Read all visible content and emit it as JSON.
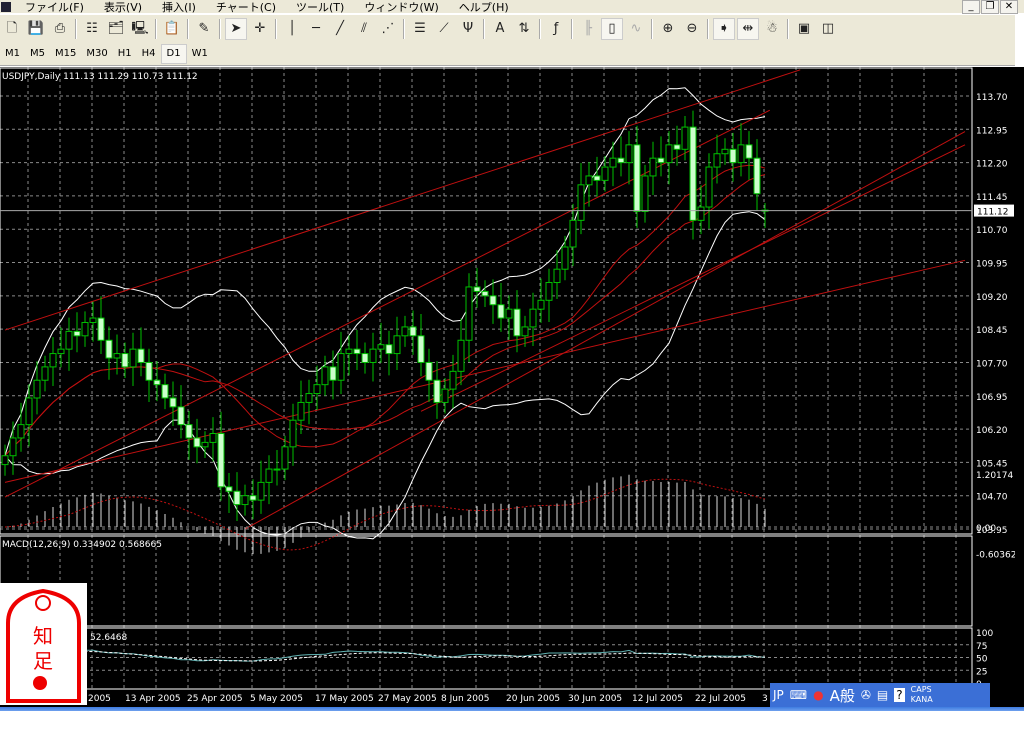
{
  "menu": [
    "ファイル(F)",
    "表示(V)",
    "挿入(I)",
    "チャート(C)",
    "ツール(T)",
    "ウィンドウ(W)",
    "ヘルプ(H)"
  ],
  "window_buttons": {
    "minimize": "_",
    "restore": "❐",
    "close": "✕"
  },
  "toolbar": [
    {
      "icon": "new-chart-icon",
      "g": "🗋"
    },
    {
      "icon": "save-icon",
      "g": "💾"
    },
    {
      "icon": "print-icon",
      "g": "⎙"
    },
    "|",
    {
      "icon": "market-watch-icon",
      "g": "☷"
    },
    {
      "icon": "navigator-icon",
      "g": "🗂"
    },
    {
      "icon": "terminal-icon",
      "g": "🖳"
    },
    "|",
    {
      "icon": "tester-icon",
      "g": "📋"
    },
    "|",
    {
      "icon": "expert-advisor-icon",
      "g": "✎"
    },
    "|",
    {
      "icon": "cursor-icon",
      "g": "➤",
      "on": true
    },
    {
      "icon": "crosshair-icon",
      "g": "✛"
    },
    "|",
    {
      "icon": "vertical-line-icon",
      "g": "│"
    },
    {
      "icon": "horizontal-line-icon",
      "g": "─"
    },
    {
      "icon": "trendline-icon",
      "g": "╱"
    },
    {
      "icon": "equidistant-channel-icon",
      "g": "⫽"
    },
    {
      "icon": "gann-fan-icon",
      "g": "⋰"
    },
    "|",
    {
      "icon": "fibonacci-icon",
      "g": "☰"
    },
    {
      "icon": "fib-fan-icon",
      "g": "⟋"
    },
    {
      "icon": "andrews-pitchfork-icon",
      "g": "Ψ"
    },
    "|",
    {
      "icon": "text-icon",
      "g": "A"
    },
    {
      "icon": "arrows-icon",
      "g": "⇅"
    },
    "|",
    {
      "icon": "functions-icon",
      "g": "ƒ"
    },
    "|",
    {
      "icon": "bar-chart-icon",
      "g": "╟",
      "dis": true
    },
    {
      "icon": "candlestick-icon",
      "g": "▯",
      "on": true
    },
    {
      "icon": "line-chart-icon",
      "g": "∿",
      "dis": true
    },
    "|",
    {
      "icon": "zoom-in-icon",
      "g": "⊕"
    },
    {
      "icon": "zoom-out-icon",
      "g": "⊖"
    },
    "|",
    {
      "icon": "auto-scroll-icon",
      "g": "➧",
      "on": true
    },
    {
      "icon": "chart-shift-icon",
      "g": "⇹",
      "on": true
    },
    {
      "icon": "experts-icon",
      "g": "☃"
    },
    "|",
    {
      "icon": "period-icon",
      "g": "▣"
    },
    {
      "icon": "template-icon",
      "g": "◫"
    }
  ],
  "timeframes": [
    "M1",
    "M5",
    "M15",
    "M30",
    "H1",
    "H4",
    "D1",
    "W1"
  ],
  "active_timeframe": "D1",
  "chart": {
    "header": "USDJPY,Daily  111.13 111.29 110.73 111.12",
    "current_price": "111.12",
    "price_ticks": [
      "113.70",
      "112.95",
      "112.20",
      "111.45",
      "110.70",
      "109.95",
      "109.20",
      "108.45",
      "107.70",
      "106.95",
      "106.20",
      "105.45",
      "104.70",
      "103.95"
    ],
    "date_labels": [
      "2005",
      "13 Apr 2005",
      "25 Apr 2005",
      "5 May 2005",
      "17 May 2005",
      "27 May 2005",
      "8 Jun 2005",
      "20 Jun 2005",
      "30 Jun 2005",
      "12 Jul 2005",
      "22 Jul 2005",
      "3"
    ],
    "macd_label": "MACD(12,26,9)  0.334902  0.568665",
    "macd_ticks": [
      "1.20174",
      "0.00",
      "-0.60362"
    ],
    "osc_label": "52.6468",
    "osc_ticks": [
      "100",
      "75",
      "50",
      "25",
      "0"
    ],
    "colors": {
      "bg": "#000000",
      "candle": "#00c000",
      "bull_body": "#000000",
      "bear_body": "#ccffcc",
      "band": "#ffffff",
      "ma": "#c01010",
      "grid": "#8a8a8a"
    }
  },
  "chart_data": {
    "type": "candlestick",
    "symbol": "USDJPY",
    "period": "Daily",
    "ylim": [
      103.95,
      113.7
    ],
    "closes": [
      105.6,
      106.0,
      106.3,
      106.9,
      107.3,
      107.6,
      107.9,
      108.0,
      108.4,
      108.3,
      108.6,
      108.7,
      108.2,
      107.8,
      107.9,
      107.6,
      108.0,
      107.7,
      107.3,
      107.2,
      106.9,
      106.7,
      106.3,
      106.0,
      105.8,
      105.9,
      106.1,
      104.9,
      104.8,
      104.5,
      104.7,
      104.6,
      105.0,
      105.3,
      105.3,
      105.8,
      106.4,
      106.8,
      107.0,
      107.2,
      107.6,
      107.3,
      107.9,
      108.0,
      107.9,
      107.7,
      108.0,
      108.1,
      107.9,
      108.3,
      108.5,
      108.3,
      107.7,
      107.3,
      106.8,
      107.1,
      107.5,
      108.2,
      109.4,
      109.3,
      109.2,
      109.0,
      108.7,
      108.9,
      108.3,
      108.5,
      108.9,
      109.1,
      109.5,
      109.8,
      110.3,
      110.9,
      111.7,
      111.9,
      111.8,
      112.1,
      112.3,
      112.2,
      112.6,
      111.1,
      111.9,
      112.3,
      112.2,
      112.6,
      112.5,
      113.0,
      110.9,
      111.2,
      112.1,
      112.4,
      112.5,
      112.2,
      112.6,
      112.3,
      111.5,
      111.12
    ],
    "last_bar": {
      "open": 111.13,
      "high": 111.29,
      "low": 110.73,
      "close": 111.12
    },
    "trendlines": [
      [
        [
          0,
          108.43
        ],
        [
          99.4,
          114.29
        ]
      ],
      [
        [
          0,
          104.67
        ],
        [
          95.6,
          113.38
        ]
      ],
      [
        [
          30,
          103.95
        ],
        [
          120,
          112.9
        ]
      ],
      [
        [
          52,
          106.6
        ],
        [
          120,
          112.6
        ]
      ],
      [
        [
          0,
          105.0
        ],
        [
          120,
          110.0
        ]
      ]
    ],
    "indicators": [
      "Bollinger Bands(20,2)",
      "Moving Average",
      "MACD(12,26,9)",
      "Oscillator"
    ]
  },
  "language_bar": {
    "lang": "JP",
    "mode": "A般",
    "caps": "CAPS",
    "kana": "KANA"
  }
}
